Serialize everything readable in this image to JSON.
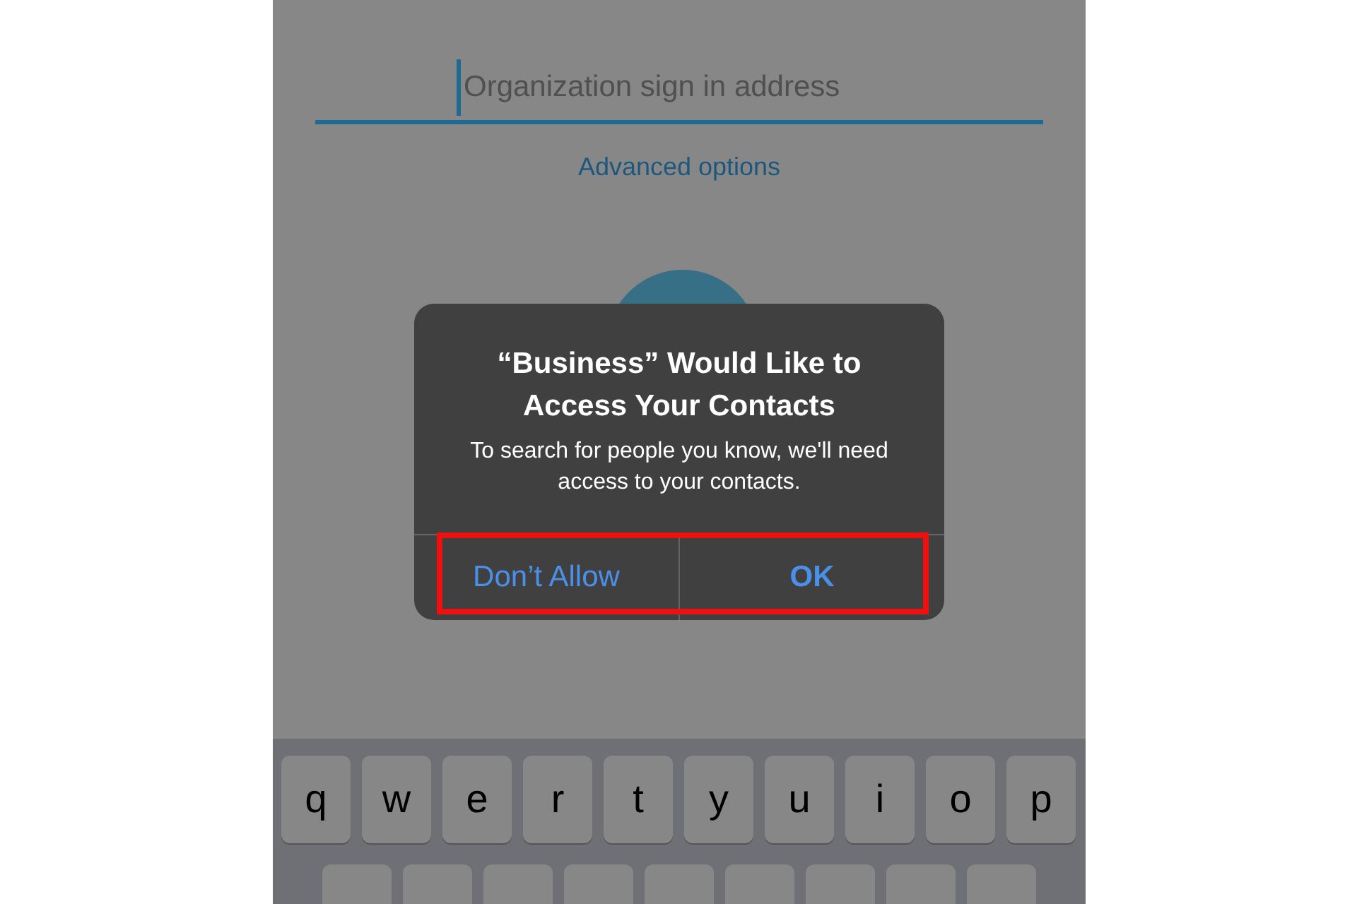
{
  "sign_in": {
    "field": {
      "placeholder": "Organization sign in address",
      "focused": true
    },
    "advanced_link": "Advanced options"
  },
  "alert": {
    "title": "“Business” Would Like to Access Your Contacts",
    "message": "To search for people you know, we'll need access to your contacts.",
    "buttons": [
      {
        "label": "Don’t Allow",
        "bold": false
      },
      {
        "label": "OK",
        "bold": true
      }
    ],
    "highlighted": true
  },
  "keyboard": {
    "rows": [
      [
        "q",
        "w",
        "e",
        "r",
        "t",
        "y",
        "u",
        "i",
        "o",
        "p"
      ]
    ]
  }
}
